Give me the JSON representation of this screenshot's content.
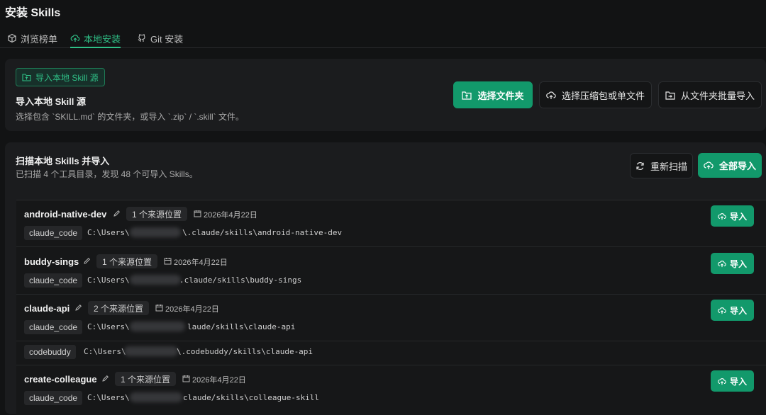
{
  "page": {
    "title": "安装 Skills"
  },
  "tabs": [
    {
      "label": "浏览榜单",
      "icon": "box-icon",
      "active": false
    },
    {
      "label": "本地安装",
      "icon": "upload-cloud-icon",
      "active": true
    },
    {
      "label": "Git 安装",
      "icon": "github-icon",
      "active": false
    }
  ],
  "local_source": {
    "badge": "导入本地 Skill 源",
    "heading": "导入本地 Skill 源",
    "description": "选择包含 `SKILL.md` 的文件夹，或导入 `.zip` / `.skill` 文件。",
    "buttons": {
      "select_folder": "选择文件夹",
      "select_archive": "选择压缩包或单文件",
      "batch_import": "从文件夹批量导入"
    }
  },
  "scan": {
    "heading": "扫描本地 Skills 并导入",
    "summary": "已扫描 4 个工具目录，发现 48 个可导入 Skills。",
    "rescan_label": "重新扫描",
    "import_all_label": "全部导入"
  },
  "skills": [
    {
      "name": "android-native-dev",
      "sources": "1 个来源位置",
      "date": "2026年4月22日",
      "locations": [
        {
          "tool": "claude_code",
          "path_prefix": "C:\\Users\\",
          "path_suffix": "\\.claude/skills\\android-native-dev"
        }
      ],
      "import_label": "导入"
    },
    {
      "name": "buddy-sings",
      "sources": "1 个来源位置",
      "date": "2026年4月22日",
      "locations": [
        {
          "tool": "claude_code",
          "path_prefix": "C:\\Users\\",
          "path_suffix": ".claude/skills\\buddy-sings"
        }
      ],
      "import_label": "导入"
    },
    {
      "name": "claude-api",
      "sources": "2 个来源位置",
      "date": "2026年4月22日",
      "locations": [
        {
          "tool": "claude_code",
          "path_prefix": "C:\\Users\\",
          "path_suffix": "laude/skills\\claude-api"
        },
        {
          "tool": "codebuddy",
          "path_prefix": "C:\\Users\\",
          "path_suffix": "\\.codebuddy/skills\\claude-api"
        }
      ],
      "import_label": "导入"
    },
    {
      "name": "create-colleague",
      "sources": "1 个来源位置",
      "date": "2026年4月22日",
      "locations": [
        {
          "tool": "claude_code",
          "path_prefix": "C:\\Users\\",
          "path_suffix": "claude/skills\\colleague-skill"
        }
      ],
      "import_label": "导入"
    }
  ]
}
